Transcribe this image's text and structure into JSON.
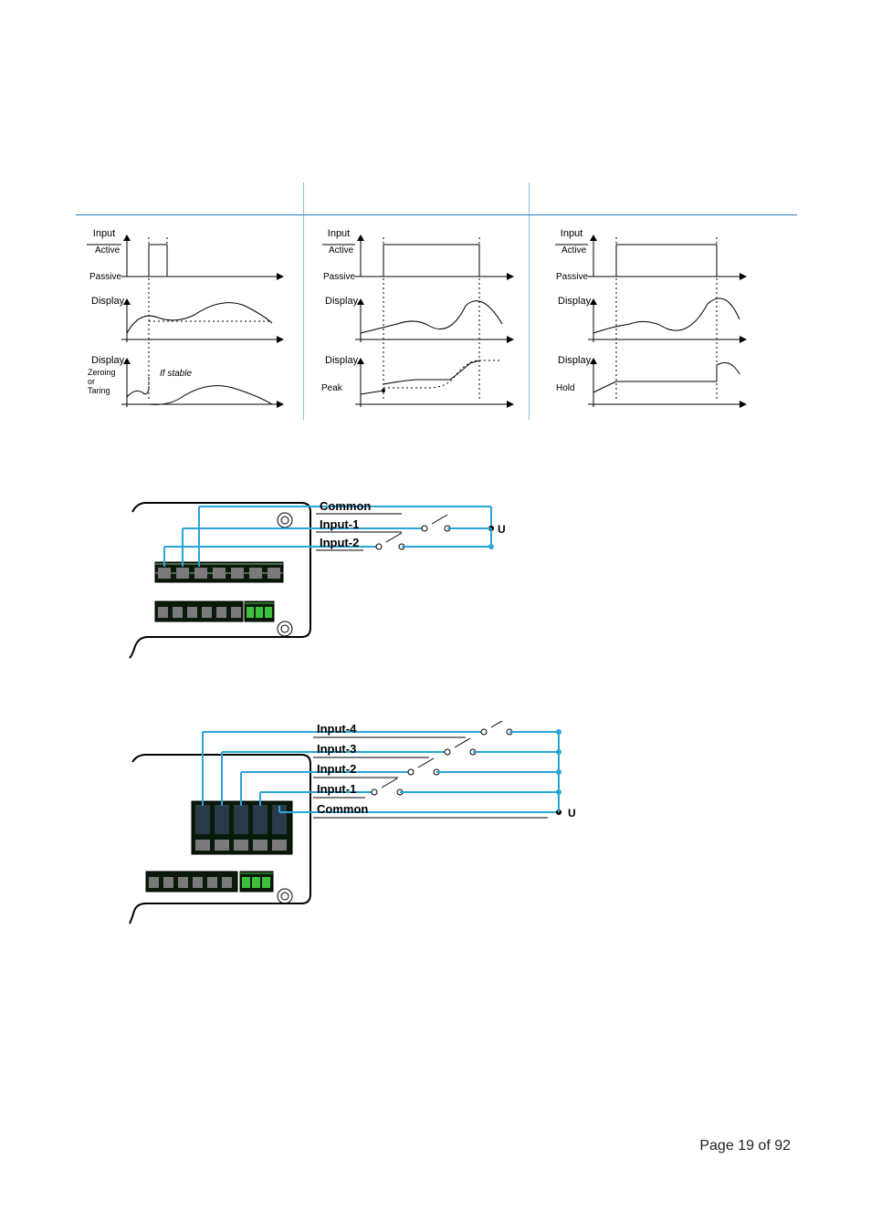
{
  "page": {
    "number": "Page 19 of 92"
  },
  "graphs": {
    "ylabel_input": "Input",
    "active": "Active",
    "passive": "Passive",
    "display": "Display",
    "ifstable": "If stable",
    "peak": "Peak",
    "hold": "Hold",
    "zeroing": "Zeroing",
    "or": "or",
    "taring": "Taring"
  },
  "wiring1": {
    "common": "Common",
    "in1": "Input-1",
    "in2": "Input-2",
    "u": "U"
  },
  "wiring2": {
    "in4": "Input-4",
    "in3": "Input-3",
    "in2": "Input-2",
    "in1": "Input-1",
    "common": "Common",
    "u": "U"
  }
}
